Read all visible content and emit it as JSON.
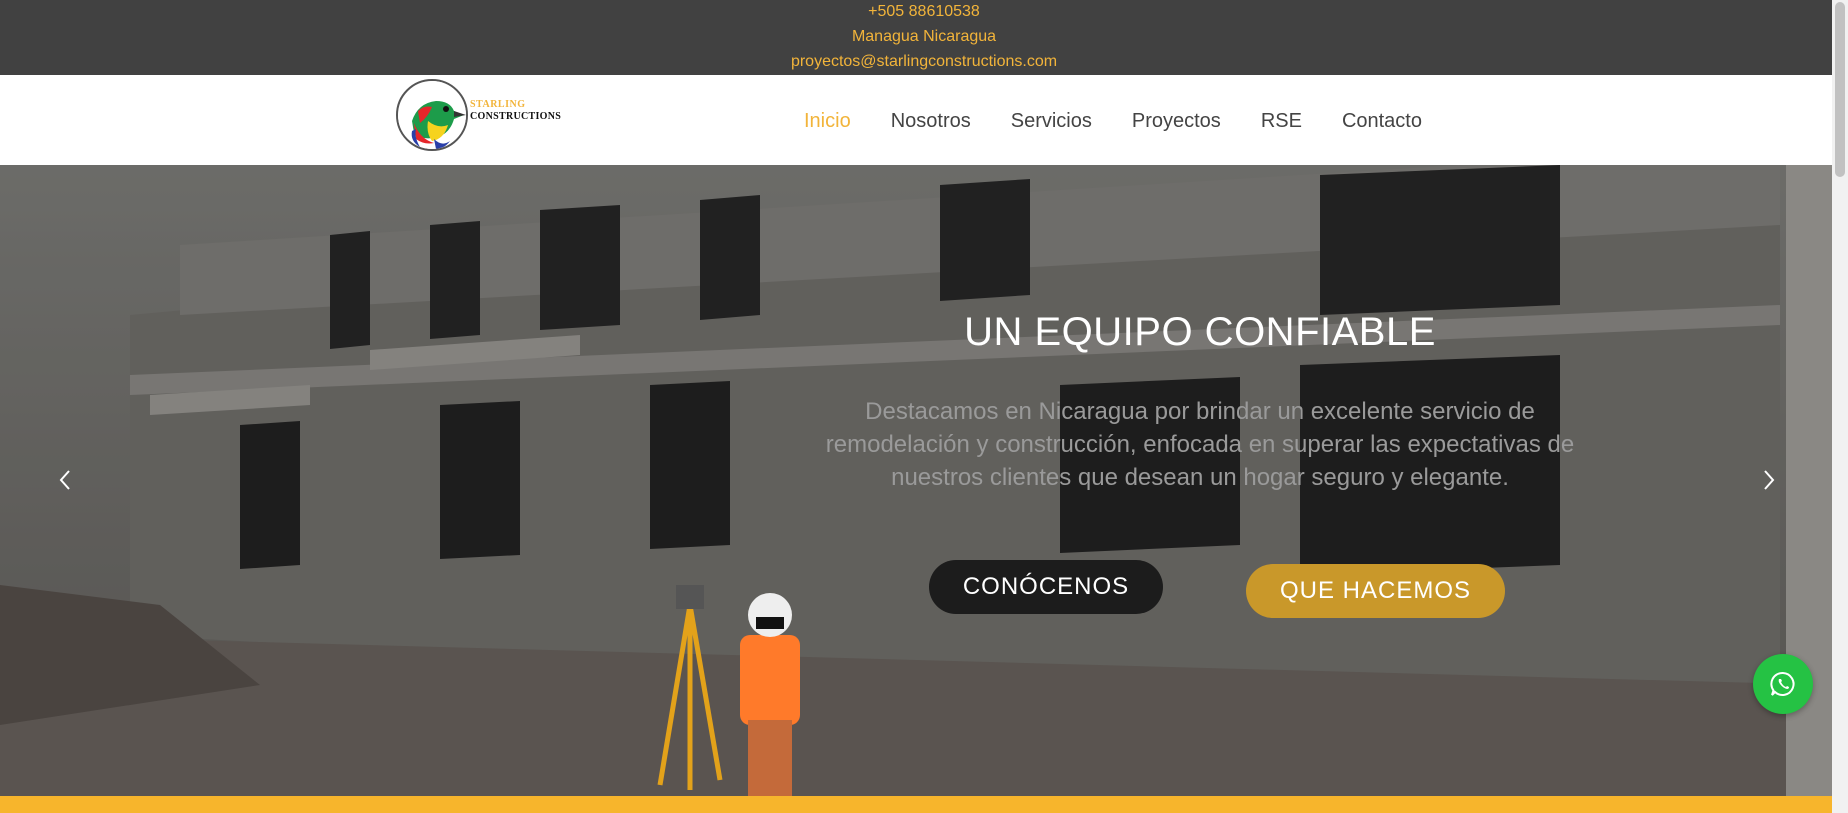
{
  "topbar": {
    "phone": "+505 88610538",
    "location": "Managua Nicaragua",
    "email": "proyectos@starlingconstructions.com"
  },
  "logo": {
    "line1": "STARLING",
    "line2": "CONSTRUCTIONS"
  },
  "nav": {
    "items": [
      {
        "label": "Inicio",
        "active": true
      },
      {
        "label": "Nosotros",
        "active": false
      },
      {
        "label": "Servicios",
        "active": false
      },
      {
        "label": "Proyectos",
        "active": false
      },
      {
        "label": "RSE",
        "active": false
      },
      {
        "label": "Contacto",
        "active": false
      }
    ]
  },
  "hero": {
    "title": "UN EQUIPO CONFIABLE",
    "subtitle": "Destacamos en Nicaragua por brindar un excelente servicio de remodelación y construcción, enfocada en superar las expectativas de nuestros clientes que desean un hogar seguro y elegante.",
    "button_primary": "CONÓCENOS",
    "button_secondary": "QUE HACEMOS",
    "prev_icon": "chevron-left-icon",
    "next_icon": "chevron-right-icon"
  },
  "whatsapp": {
    "icon": "whatsapp-icon",
    "color": "#25c244"
  },
  "colors": {
    "accent": "#f2b43a",
    "topbar_bg": "#414141",
    "button_gold": "#c9982a",
    "strip": "#f7b52c"
  }
}
